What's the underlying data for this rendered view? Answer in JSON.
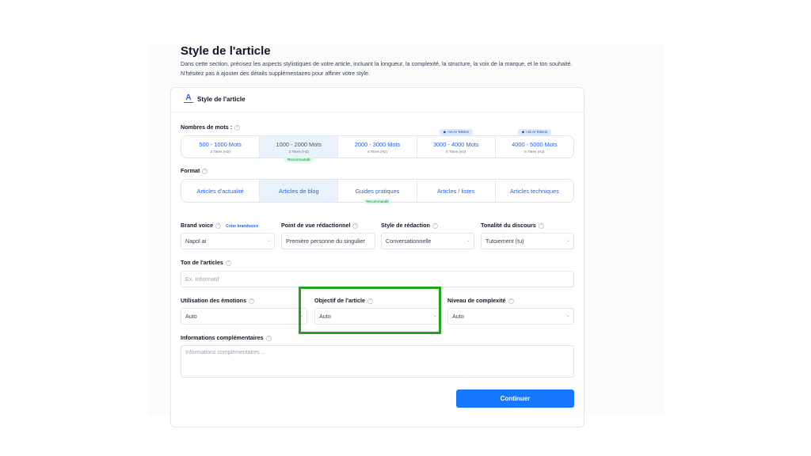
{
  "page": {
    "title": "Style de l'article",
    "description": "Dans cette section, précisez les aspects stylistiques de votre article, incluant la longueur, la complexité, la structure, la voix de la marque, et le ton souhaité. N'hésitez pas à ajouter des détails supplémentaires pour affiner votre style."
  },
  "card": {
    "title": "Style de l'article",
    "icon": "text-style-icon"
  },
  "words": {
    "label": "Nombres de mots :",
    "options": [
      {
        "main": "500 - 1000 Mots",
        "sub": "2 Titres (H2)"
      },
      {
        "main": "1000 - 2000 Mots",
        "sub": "3 Titres (H2)",
        "badge": "Recommandé"
      },
      {
        "main": "2000 - 3000 Mots",
        "sub": "4 Titres (H2)"
      },
      {
        "main": "3000 - 4000 Mots",
        "sub": "5 Titres (H2)",
        "token": "+10 AI Tokens"
      },
      {
        "main": "4000 - 5000 Mots",
        "sub": "6 Titres (H2)",
        "token": "+15 AI Tokens"
      }
    ],
    "selected_index": 1
  },
  "format": {
    "label": "Format",
    "options": [
      {
        "main": "Articles d'actualité"
      },
      {
        "main": "Articles de blog"
      },
      {
        "main": "Guides pratiques",
        "badge": "Recommandé"
      },
      {
        "main": "Articles / listes"
      },
      {
        "main": "Articles techniques"
      }
    ],
    "selected_index": 1
  },
  "brand_voice": {
    "label": "Brand voice",
    "link": "Créer brandvoice",
    "value": "Napol ai"
  },
  "point_of_view": {
    "label": "Point de vue rédactionnel",
    "value": "Première personne du singulier"
  },
  "writing_style": {
    "label": "Style de rédaction",
    "value": "Conversationnelle"
  },
  "tone_discourse": {
    "label": "Tonalité du discours",
    "value": "Tutoiement (tu)"
  },
  "article_tone": {
    "label": "Ton de l'articles",
    "placeholder": "Ex. Informatif"
  },
  "emotions": {
    "label": "Utilisation des émotions",
    "value": "Auto"
  },
  "objective": {
    "label": "Objectif de l'article",
    "value": "Auto"
  },
  "complexity": {
    "label": "Niveau de complexité",
    "value": "Auto"
  },
  "additional": {
    "label": "Informations complémentaires",
    "placeholder": "Informations complémentaires ..."
  },
  "continue_button": "Continuer",
  "colors": {
    "accent": "#1677ff",
    "highlight": "#22a31c",
    "badge_green": "#dcfce7"
  }
}
